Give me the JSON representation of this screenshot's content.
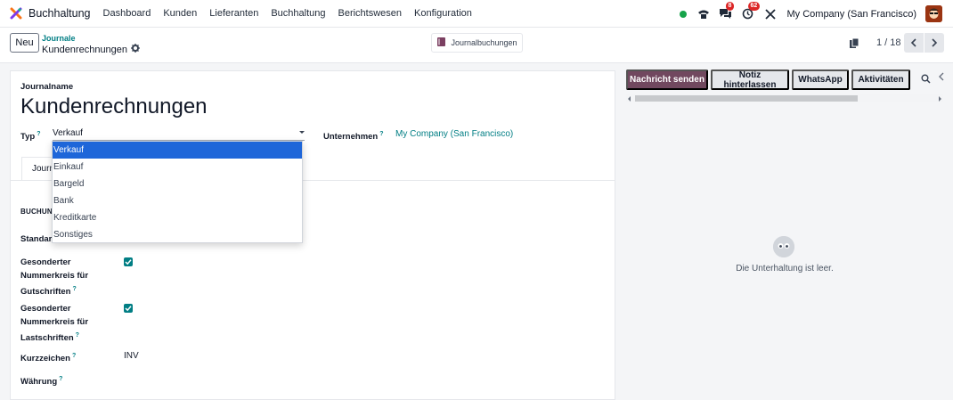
{
  "app": {
    "name": "Buchhaltung",
    "logo_icon": "odoo-accounting-logo"
  },
  "menu": [
    {
      "label": "Dashboard"
    },
    {
      "label": "Kunden"
    },
    {
      "label": "Lieferanten"
    },
    {
      "label": "Buchhaltung"
    },
    {
      "label": "Berichtswesen"
    },
    {
      "label": "Konfiguration"
    }
  ],
  "systray": {
    "status_color": "#16a34a",
    "messages_badge": "8",
    "activities_badge": "62",
    "company": "My Company (San Francisco)"
  },
  "control_panel": {
    "new_button": "Neu",
    "breadcrumb_parent": "Journale",
    "breadcrumb_current": "Kundenrechnungen",
    "smart_button": "Journalbuchungen",
    "pager": "1 / 18"
  },
  "form": {
    "name_label": "Journalname",
    "record_title": "Kundenrechnungen",
    "type_label": "Typ",
    "type_value": "Verkauf",
    "company_label": "Unternehmen",
    "company_value": "My Company (San Francisco)",
    "tab_label": "Journ",
    "section_title": "BUCHUN",
    "default_account_label": "Standard",
    "refund_sequence_label_1": "Gesonderter",
    "refund_sequence_label_2": "Nummerkreis für",
    "refund_sequence_label_3": "Gutschriften",
    "refund_sequence_checked": true,
    "payment_sequence_label_1": "Gesonderter",
    "payment_sequence_label_2": "Nummerkreis für",
    "payment_sequence_label_3": "Lastschriften",
    "payment_sequence_checked": true,
    "code_label": "Kurzzeichen",
    "code_value": "INV",
    "currency_label": "Währung",
    "help_mark": "?"
  },
  "type_dropdown": {
    "options": [
      "Verkauf",
      "Einkauf",
      "Bargeld",
      "Bank",
      "Kreditkarte",
      "Sonstiges"
    ],
    "selected": "Verkauf"
  },
  "chatter": {
    "send_message": "Nachricht senden",
    "log_note": "Notiz hinterlassen",
    "whatsapp": "WhatsApp",
    "activities": "Aktivitäten",
    "empty_message": "Die Unterhaltung ist leer."
  },
  "colors": {
    "accent": "#017e84",
    "send_button": "#71485f",
    "selected_option": "#1e66d9",
    "badge": "#dc2626"
  }
}
